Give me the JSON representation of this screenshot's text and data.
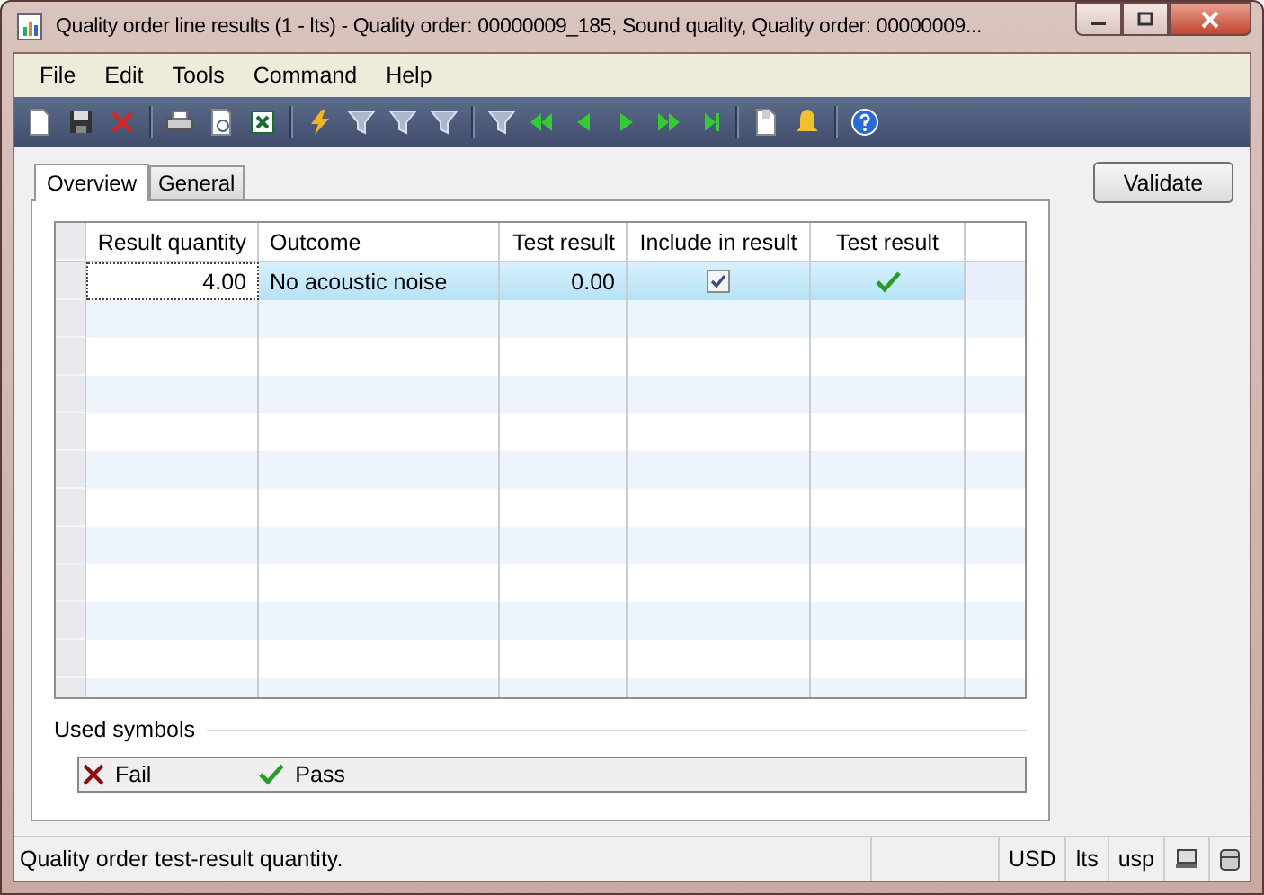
{
  "window": {
    "title": "Quality order line results (1 - lts) - Quality order: 00000009_185, Sound quality, Quality order: 00000009..."
  },
  "menu": [
    "File",
    "Edit",
    "Tools",
    "Command",
    "Help"
  ],
  "tabs": [
    {
      "label": "Overview",
      "selected": true
    },
    {
      "label": "General",
      "selected": false
    }
  ],
  "grid": {
    "columns": [
      "Result quantity",
      "Outcome",
      "Test result",
      "Include in result",
      "Test result"
    ],
    "rows": [
      {
        "result_quantity": "4.00",
        "outcome": "No acoustic noise",
        "test_result": "0.00",
        "include_in_result": true,
        "passed": true,
        "selected": true
      }
    ]
  },
  "legend": {
    "title": "Used symbols",
    "items": [
      {
        "label": "Fail",
        "kind": "fail"
      },
      {
        "label": "Pass",
        "kind": "pass"
      }
    ]
  },
  "validate_button": "Validate",
  "status_bar": {
    "message": "Quality order test-result quantity.",
    "fields": [
      "USD",
      "lts",
      "usp"
    ]
  }
}
